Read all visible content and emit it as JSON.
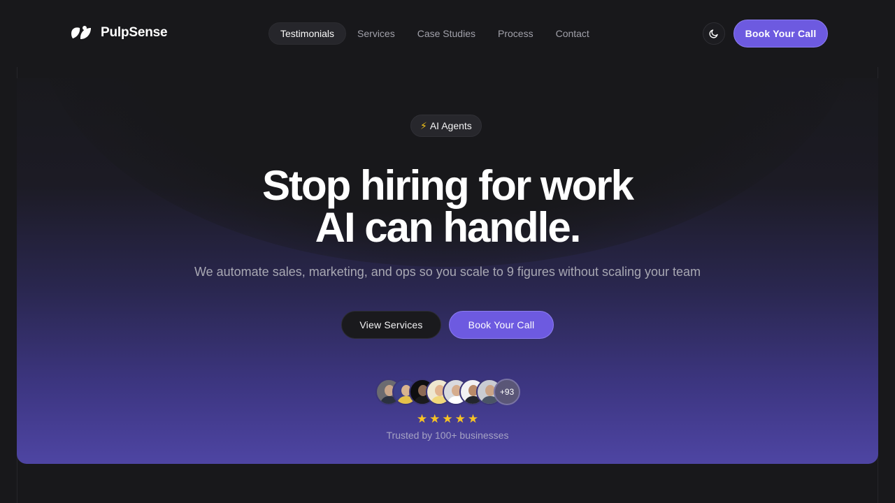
{
  "brand": {
    "name": "PulpSense",
    "icon": "leaf-logo-icon"
  },
  "nav": {
    "items": [
      {
        "label": "Testimonials",
        "active": true
      },
      {
        "label": "Services",
        "active": false
      },
      {
        "label": "Case Studies",
        "active": false
      },
      {
        "label": "Process",
        "active": false
      },
      {
        "label": "Contact",
        "active": false
      }
    ]
  },
  "header": {
    "theme_toggle_icon": "moon-icon",
    "cta_label": "Book Your Call"
  },
  "hero": {
    "badge": {
      "icon": "lightning-icon",
      "label": "AI Agents"
    },
    "headline_line1": "Stop hiring for work",
    "headline_line2": "AI can handle.",
    "subhead": "We automate sales, marketing, and ops so you scale to 9 figures without scaling your team",
    "secondary_cta": "View Services",
    "primary_cta": "Book Your Call"
  },
  "social_proof": {
    "avatar_count": 7,
    "more_label": "+93",
    "rating": 5,
    "trusted_text": "Trusted by 100+ businesses"
  },
  "colors": {
    "background": "#18181b",
    "accent": "#6d5ae0",
    "accent_border": "#8b7cf0",
    "star": "#f7c325"
  }
}
